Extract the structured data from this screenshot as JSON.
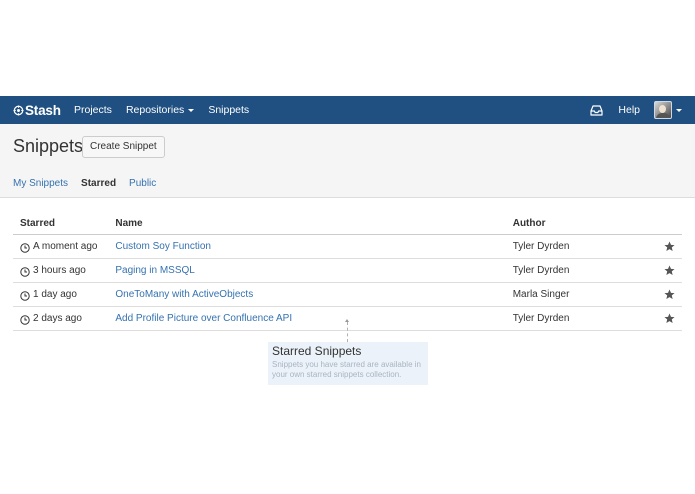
{
  "header": {
    "brand": "Stash",
    "nav": [
      {
        "label": "Projects"
      },
      {
        "label": "Repositories"
      },
      {
        "label": "Snippets"
      }
    ],
    "help_label": "Help",
    "background": "#205081"
  },
  "page": {
    "title": "Snippets",
    "create_button_label": "Create Snippet",
    "tabs": [
      {
        "label": "My Snippets",
        "active": false
      },
      {
        "label": "Starred",
        "active": true
      },
      {
        "label": "Public",
        "active": false
      }
    ]
  },
  "table": {
    "columns": [
      "Starred",
      "Name",
      "Author"
    ],
    "rows": [
      {
        "starred": "A moment ago",
        "name": "Custom Soy Function",
        "author": "Tyler Dyrden"
      },
      {
        "starred": "3 hours ago",
        "name": "Paging in MSSQL",
        "author": "Tyler Dyrden"
      },
      {
        "starred": "1 day ago",
        "name": "OneToMany with ActiveObjects",
        "author": "Marla Singer"
      },
      {
        "starred": "2 days ago",
        "name": "Add Profile Picture over Confluence API",
        "author": "Tyler Dyrden"
      }
    ]
  },
  "callout": {
    "title": "Starred Snippets",
    "text": "Snippets you have starred are available in your own starred snippets collection."
  },
  "colors": {
    "link": "#3572b0",
    "callout_bg": "#ebf2f9"
  }
}
